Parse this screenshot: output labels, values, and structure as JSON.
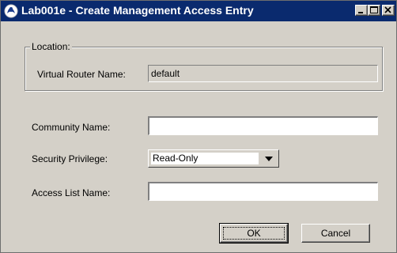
{
  "window": {
    "title": "Lab001e - Create Management Access Entry",
    "icon": "app-globe-icon",
    "controls": {
      "minimize": "minimize-icon",
      "maximize": "maximize-icon",
      "close": "close-icon"
    },
    "colors": {
      "titlebar": "#0a246a",
      "face": "#d4d0c8"
    }
  },
  "location": {
    "group_label": "Location:",
    "virtual_router_label": "Virtual Router Name:",
    "virtual_router_value": "default"
  },
  "form": {
    "community_label": "Community Name:",
    "community_value": "",
    "security_label": "Security Privilege:",
    "security_value": "Read-Only",
    "access_list_label": "Access List Name:",
    "access_list_value": ""
  },
  "buttons": {
    "ok": "OK",
    "cancel": "Cancel"
  }
}
